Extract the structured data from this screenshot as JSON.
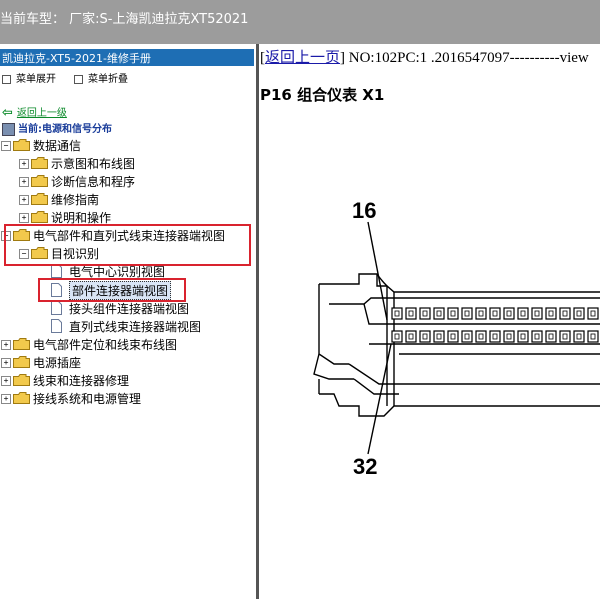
{
  "window": {
    "title": "当前车型：  厂家:S-上海凯迪拉克XT52021"
  },
  "left_panel": {
    "manual_title": "凯迪拉克-XT5-2021-维修手册",
    "toolbar": {
      "expand_label": "菜单展开",
      "collapse_label": "菜单折叠"
    },
    "back_link": "返回上一级",
    "current_location": "当前:电源和信号分布",
    "tree": {
      "root": "数据通信",
      "items": [
        "示意图和布线图",
        "诊断信息和程序",
        "维修指南",
        "说明和操作",
        "电气部件和直列式线束连接器端视图",
        "目视识别",
        "电气中心识别视图",
        "部件连接器端视图",
        "接头组件连接器端视图",
        "直列式线束连接器端视图",
        "电气部件定位和线束布线图",
        "电源插座",
        "线束和连接器修理",
        "接线系统和电源管理"
      ]
    }
  },
  "right_panel": {
    "back_link": "返回上一页",
    "doc_id": "NO:102PC:1 .2016547097----------view",
    "doc_title": "P16 组合仪表 X1",
    "figure": {
      "callout_top": "16",
      "callout_bottom": "32"
    }
  },
  "colors": {
    "titlebar_bg": "#9c9c9c",
    "manual_header_bg": "#1e6eb4",
    "highlight_border": "#d9232e",
    "link_green": "#0b8a2a",
    "link_blue": "#1a1aa8",
    "folder_yellow": "#f2c94c"
  }
}
